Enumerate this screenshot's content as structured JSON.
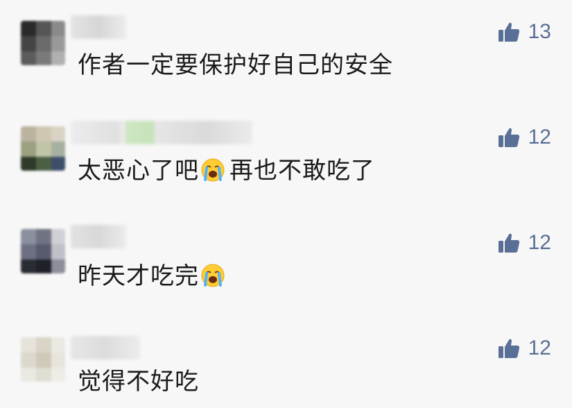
{
  "colors": {
    "background": "#f7f7f7",
    "like_icon": "#5a6f96",
    "text": "#1a1a1a"
  },
  "comments": [
    {
      "text": "作者一定要保护好自己的安全",
      "likes": "13"
    },
    {
      "text_before": "太恶心了吧",
      "emoji": "loudly-crying-face",
      "text_after": "再也不敢吃了",
      "likes": "12"
    },
    {
      "text_before": "昨天才吃完",
      "emoji": "loudly-crying-face",
      "likes": "12"
    },
    {
      "text": "觉得不好吃",
      "likes": "12"
    }
  ],
  "icons": {
    "like": "thumbs-up-icon",
    "emoji": "loudly-crying-face-emoji"
  }
}
